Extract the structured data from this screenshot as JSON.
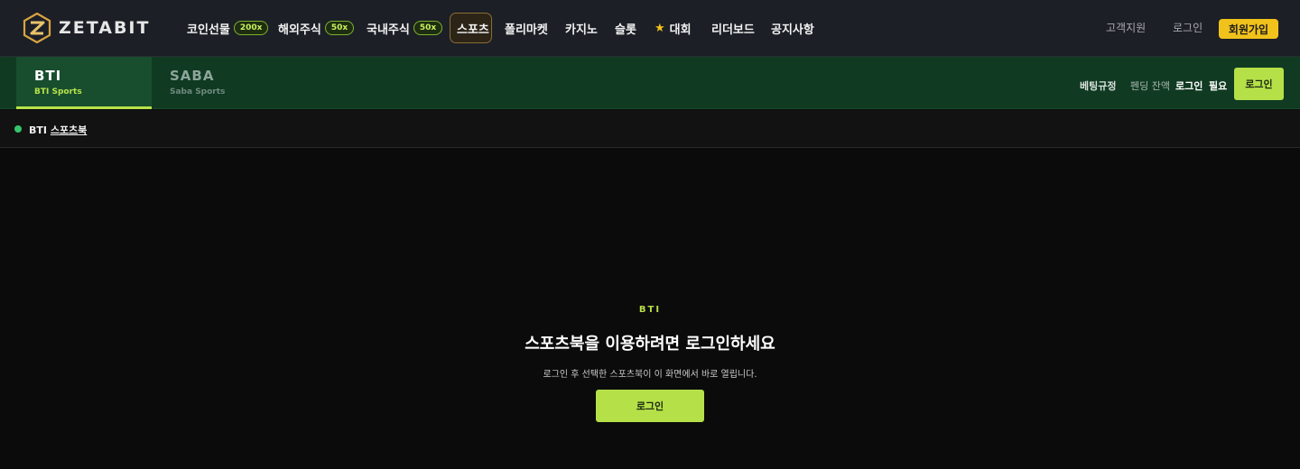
{
  "brand": {
    "logo_text": "ZETABIT",
    "logo_icon": "zetabit-logo-icon",
    "accent_color": "#d9a441"
  },
  "topnav": {
    "items": [
      {
        "label": "코인선물",
        "badge": "200x"
      },
      {
        "label": "해외주식",
        "badge": "50x"
      },
      {
        "label": "국내주식",
        "badge": "50x"
      },
      {
        "label": "스포츠",
        "active": true
      },
      {
        "label": "폴리마켓"
      },
      {
        "label": "카지노"
      },
      {
        "label": "슬롯"
      },
      {
        "label": "대회",
        "icon": "star-icon"
      },
      {
        "label": "리더보드"
      },
      {
        "label": "공지사항"
      }
    ],
    "support_label": "고객지원",
    "login_label": "로그인",
    "signup_label": "회원가입",
    "signup_color": "#f1c21b"
  },
  "provider_bar": {
    "tabs": [
      {
        "title": "BTI",
        "subtitle": "BTI Sports",
        "active": true
      },
      {
        "title": "SABA",
        "subtitle": "Saba Sports",
        "active": false
      }
    ],
    "rules_label": "베팅규정",
    "pending_label": "펜딩 잔액",
    "login_required_a": "로그인",
    "login_required_b": "필요",
    "login_button": "로그인",
    "accent_color": "#b5e048"
  },
  "breadcrumb": {
    "provider": "BTI",
    "section": "스포츠북",
    "status_color": "#36c46b"
  },
  "empty_state": {
    "tag": "BTI",
    "title": "스포츠북을 이용하려면 로그인하세요",
    "description": "로그인 후 선택한 스포츠북이 이 화면에서 바로 열립니다.",
    "button": "로그인"
  }
}
